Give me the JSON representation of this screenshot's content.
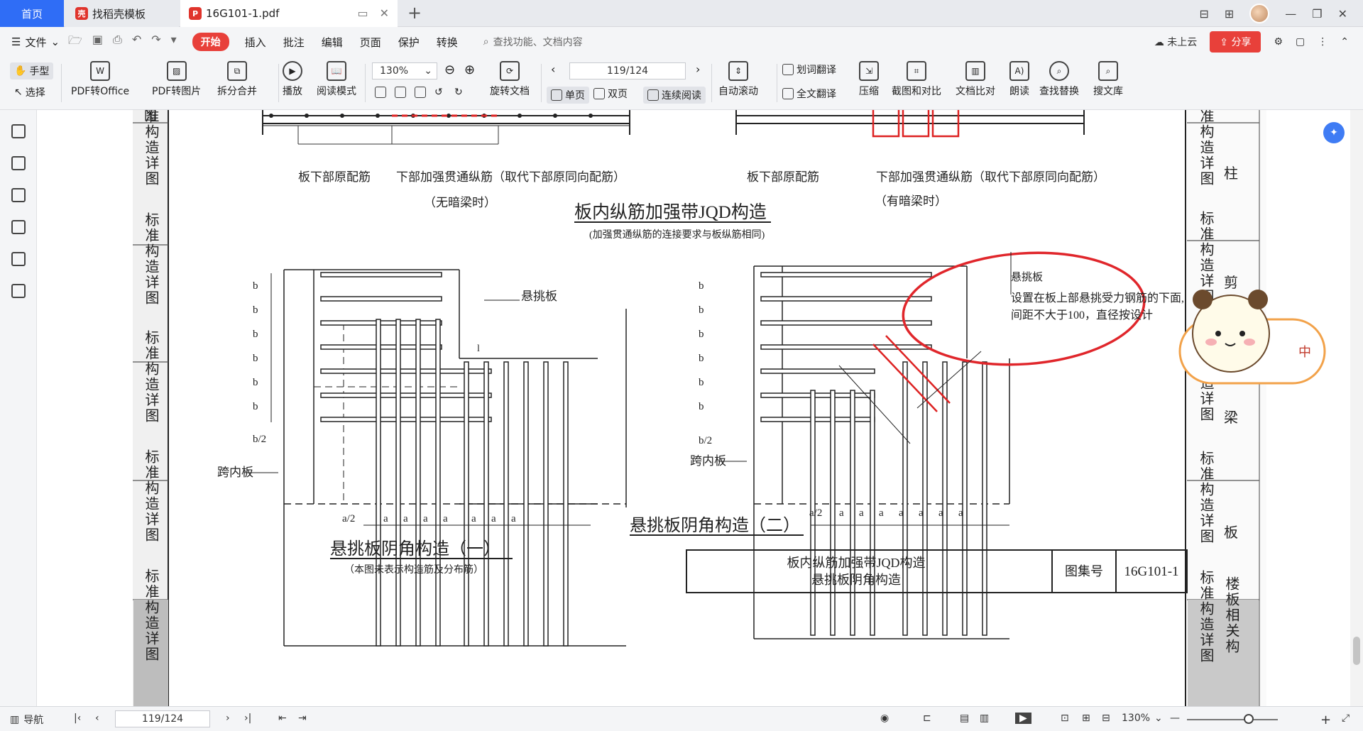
{
  "tabs": {
    "home": "首页",
    "template": "找稻壳模板",
    "pdf": "16G101-1.pdf"
  },
  "menu": {
    "file": "文件",
    "start": "开始",
    "items": [
      "插入",
      "批注",
      "编辑",
      "页面",
      "保护",
      "转换"
    ],
    "search_placeholder": "查找功能、文档内容",
    "cloud_status": "未上云",
    "share": "分享"
  },
  "toolbar": {
    "hand": "手型",
    "select": "选择",
    "pdf_to_office": "PDF转Office",
    "pdf_to_image": "PDF转图片",
    "split_merge": "拆分合并",
    "play": "播放",
    "read_mode": "阅读模式",
    "zoom": "130%",
    "rotate": "旋转文档",
    "single_page": "单页",
    "double_page": "双页",
    "continuous": "连续阅读",
    "page_indicator": "119/124",
    "auto_scroll": "自动滚动",
    "word_translate": "划词翻译",
    "full_translate": "全文翻译",
    "compress": "压缩",
    "capture_compare": "截图和对比",
    "doc_compare": "文档比对",
    "read_aloud": "朗读",
    "find_replace": "查找替换",
    "search_library": "搜文库"
  },
  "document": {
    "tab_fragment_top": "图",
    "side_tab_text": "标准构造详图",
    "right_tabs": [
      "柱",
      "剪",
      "梁",
      "板",
      "楼板相关构"
    ],
    "top_left_labels": {
      "bottom_original": "板下部原配筋",
      "reinforced": "下部加强贯通纵筋（取代下部原同向配筋）",
      "case": "（无暗梁时）"
    },
    "top_right_labels": {
      "bottom_original": "板下部原配筋",
      "reinforced": "下部加强贯通纵筋（取代下部原同向配筋）",
      "case": "（有暗梁时）"
    },
    "jqd_title": "板内纵筋加强带JQD构造",
    "jqd_subtitle": "(加强贯通纵筋的连接要求与板纵筋相同)",
    "cantilever_label": "悬挑板",
    "inner_span_label": "跨内板",
    "left_dim_b": "b",
    "left_dim_b2": "b/2",
    "bottom_dim_a2": "a/2",
    "bottom_dim_a": "a",
    "la_label": "l",
    "diagram1_title": "悬挑板阴角构造（一）",
    "diagram1_note": "（本图未表示构造筋及分布筋）",
    "diagram2_title": "悬挑板阴角构造（二）",
    "annotation_line1": "设置在板上部悬挑受力钢筋的下面,",
    "annotation_line2": "间距不大于100，直径按设计",
    "title_block_line1": "板内纵筋加强带JQD构造",
    "title_block_line2": "悬挑板阴角构造",
    "atlas_label": "图集号",
    "atlas_value": "16G101-1"
  },
  "mascot": {
    "badge": "中"
  },
  "status": {
    "nav": "导航",
    "page": "119/124",
    "zoom": "130%"
  }
}
